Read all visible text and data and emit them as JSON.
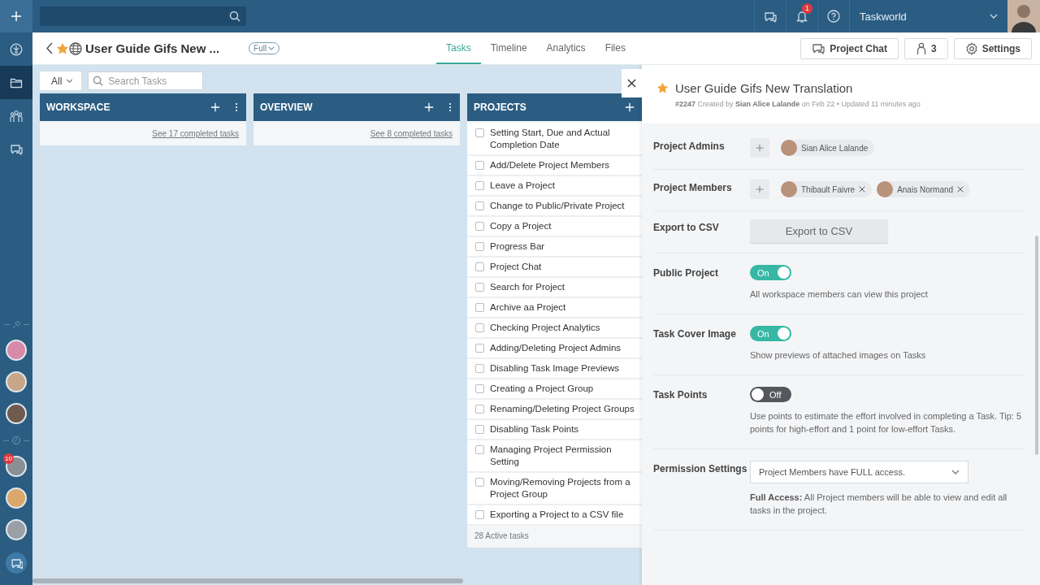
{
  "top_bar": {
    "notification_count": "1",
    "workspace": "Taskworld"
  },
  "rail": {
    "items": [
      {
        "kind": "compass",
        "selected": false
      },
      {
        "kind": "folder",
        "selected": true
      },
      {
        "kind": "team",
        "selected": false
      },
      {
        "kind": "chat",
        "selected": false
      },
      {
        "kind": "pin-divider"
      },
      {
        "kind": "avatar",
        "color": "#d98aa8"
      },
      {
        "kind": "avatar",
        "color": "#c9a58a"
      },
      {
        "kind": "avatar",
        "color": "#6e5a4e"
      },
      {
        "kind": "clock-divider"
      },
      {
        "kind": "avatar",
        "color": "#8a8f96",
        "badge": "10"
      },
      {
        "kind": "avatar",
        "color": "#d9a86a"
      },
      {
        "kind": "avatar",
        "color": "#9aa0a6"
      },
      {
        "kind": "new-chat"
      }
    ]
  },
  "header": {
    "title": "User Guide Gifs New ...",
    "access": "Full",
    "tabs": [
      {
        "label": "Tasks",
        "selected": true
      },
      {
        "label": "Timeline",
        "selected": false
      },
      {
        "label": "Analytics",
        "selected": false
      },
      {
        "label": "Files",
        "selected": false
      }
    ],
    "buttons": [
      {
        "kind": "chat",
        "label": "Project Chat"
      },
      {
        "kind": "members",
        "label": "3"
      },
      {
        "kind": "settings",
        "label": "Settings"
      }
    ]
  },
  "toolbar": {
    "filter": "All",
    "search": {
      "placeholder": "Search Tasks"
    }
  },
  "board": {
    "columns": [
      {
        "title": "WORKSPACE",
        "menu": true,
        "footer_link": "See 17 completed tasks"
      },
      {
        "title": "OVERVIEW",
        "menu": true,
        "footer_link": "See 8 completed tasks"
      },
      {
        "title": "PROJECTS",
        "menu": false,
        "footer": "28 Active tasks",
        "tasks": [
          {
            "title": "Setting Start, Due and Actual Completion Date",
            "checked": false
          },
          {
            "title": "Add/Delete Project Members",
            "checked": false
          },
          {
            "title": "Leave a Project",
            "checked": false
          },
          {
            "title": "Change to Public/Private Project",
            "checked": false
          },
          {
            "title": "Copy a Project",
            "checked": false
          },
          {
            "title": "Progress Bar",
            "checked": false
          },
          {
            "title": "Project Chat",
            "checked": false
          },
          {
            "title": "Search for Project",
            "checked": false
          },
          {
            "title": "Archive aa Project",
            "checked": false
          },
          {
            "title": "Checking Project Analytics",
            "checked": false
          },
          {
            "title": "Adding/Deleting Project Admins",
            "checked": false
          },
          {
            "title": "Disabling Task Image Previews",
            "checked": false
          },
          {
            "title": "Creating a Project Group",
            "checked": false
          },
          {
            "title": "Renaming/Deleting Project Groups",
            "checked": false
          },
          {
            "title": "Disabling Task Points",
            "checked": false
          },
          {
            "title": "Managing Project Permission Setting",
            "checked": false
          },
          {
            "title": "Moving/Removing Projects from a Project Group",
            "checked": false
          },
          {
            "title": "Exporting a Project to a CSV file",
            "checked": false
          }
        ]
      }
    ]
  },
  "panel": {
    "title": "User Guide Gifs New Translation",
    "meta": "**#2247** Created by **Sian Alice Lalande** on Feb 22 • Updated 11 minutes ago",
    "settings": [
      {
        "kind": "people",
        "label": "Project Admins",
        "people": [
          {
            "name": "Sian Alice Lalande",
            "removable": false
          }
        ]
      },
      {
        "kind": "people",
        "label": "Project Members",
        "people": [
          {
            "name": "Thibault Faivre",
            "removable": true
          },
          {
            "name": "Anais Normand",
            "removable": true
          }
        ]
      },
      {
        "kind": "button",
        "label": "Export to CSV",
        "button": "Export to CSV"
      },
      {
        "kind": "toggle",
        "label": "Public Project",
        "on": true,
        "state_label": "On",
        "description": "All workspace members can view this project"
      },
      {
        "kind": "toggle",
        "label": "Task Cover Image",
        "on": true,
        "state_label": "On",
        "description": "Show previews of attached images on Tasks"
      },
      {
        "kind": "toggle",
        "label": "Task Points",
        "on": false,
        "state_label": "Off",
        "description": "Use points to estimate the effort involved in completing a Task. Tip: 5 points for high-effort and 1 point for low-effort Tasks."
      },
      {
        "kind": "select",
        "label": "Permission Settings",
        "value": "Project Members have FULL access.",
        "description": "**Full Access:** All Project members will be able to view and edit all tasks in the project."
      }
    ]
  }
}
